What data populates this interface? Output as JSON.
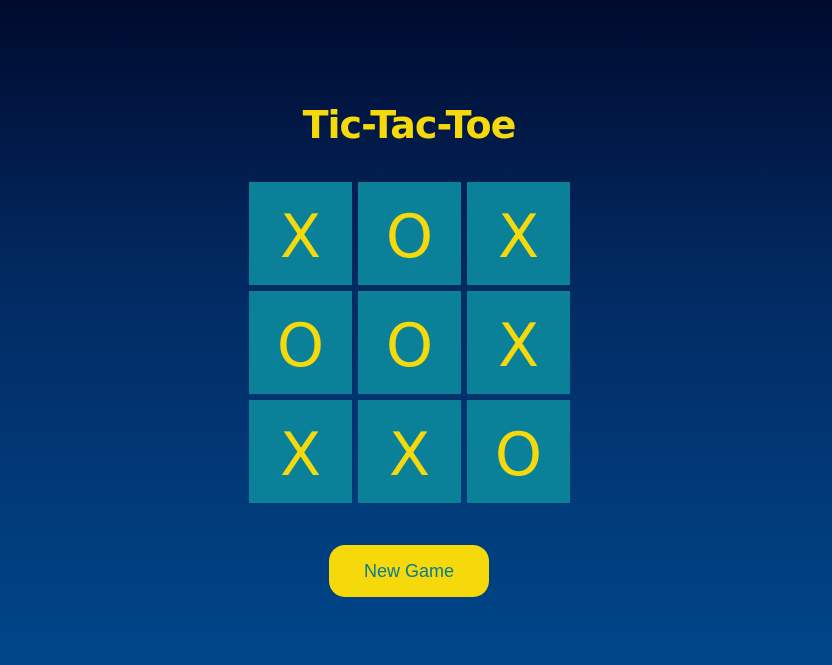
{
  "title": "Tic-Tac-Toe",
  "board": {
    "cells": [
      "X",
      "O",
      "X",
      "O",
      "O",
      "X",
      "X",
      "X",
      "O"
    ]
  },
  "new_game_label": "New Game",
  "colors": {
    "accent": "#f5d90a",
    "cell": "#0a8099",
    "background_top": "#000a2e",
    "background_bottom": "#00478a"
  }
}
